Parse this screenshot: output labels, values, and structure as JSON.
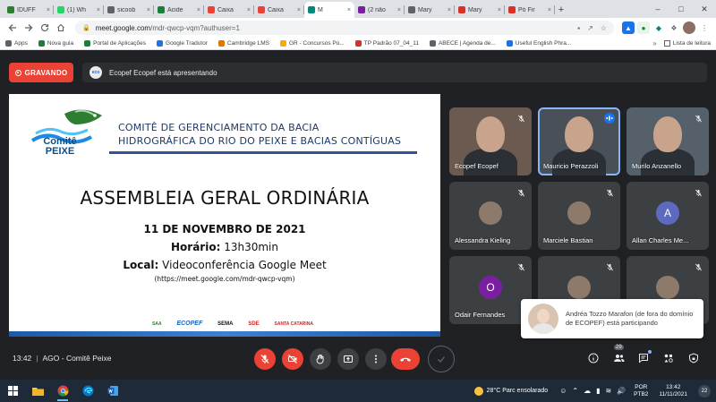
{
  "browser": {
    "tabs": [
      {
        "label": "IDUFF",
        "fav_color": "#2e7d32"
      },
      {
        "label": "(1) Wh",
        "fav_color": "#25d366"
      },
      {
        "label": "sicoob",
        "fav_color": "#5f6368"
      },
      {
        "label": "Acide",
        "fav_color": "#188038"
      },
      {
        "label": "Caixa",
        "fav_color": "#ea4335"
      },
      {
        "label": "Caixa",
        "fav_color": "#ea4335"
      },
      {
        "label": "M",
        "fav_color": "#00897b",
        "active": true
      },
      {
        "label": "(2 não",
        "fav_color": "#7b1fa2"
      },
      {
        "label": "Mary",
        "fav_color": "#5f6368"
      },
      {
        "label": "Mary",
        "fav_color": "#d93025"
      },
      {
        "label": "Pó Fir",
        "fav_color": "#d93025"
      }
    ],
    "url_host": "meet.google.com",
    "url_path": "/mdr-qwcp-vqm?authuser=1",
    "bookmarks": [
      {
        "label": "Apps",
        "color": "#5f6368"
      },
      {
        "label": "Nova guia",
        "color": "#188038"
      },
      {
        "label": "Portal de Aplicações",
        "color": "#188038"
      },
      {
        "label": "Google Tradutor",
        "color": "#1a73e8"
      },
      {
        "label": "Cambridge LMS",
        "color": "#e37400"
      },
      {
        "label": "GR - Concursos Pú...",
        "color": "#f9ab00"
      },
      {
        "label": "TP Padrão 07_04_11",
        "color": "#d93025"
      },
      {
        "label": "ABECE | Agenda de...",
        "color": "#5f6368"
      },
      {
        "label": "Useful English Phra...",
        "color": "#1a73e8"
      }
    ],
    "reading_list": "Lista de leitura"
  },
  "meet": {
    "recording_label": "GRAVANDO",
    "presenting_text": "Ecopef Ecopef está apresentando",
    "slide": {
      "logo_line1": "Comitê",
      "logo_line2": "PEIXE",
      "header_line1": "COMITÊ DE GERENCIAMENTO DA BACIA",
      "header_line2": "HIDROGRÁFICA DO RIO DO PEIXE E BACIAS CONTÍGUAS",
      "title": "ASSEMBLEIA GERAL ORDINÁRIA",
      "date": "11 DE NOVEMBRO DE 2021",
      "time_label": "Horário:",
      "time_value": "13h30min",
      "place_label": "Local:",
      "place_value": "Videoconferência Google Meet",
      "link": "(https://meet.google.com/mdr-qwcp-vqm)",
      "footer_logos": [
        "SAA",
        "ECOPEF",
        "SEMA",
        "SDE",
        "SANTA CATARINA"
      ]
    },
    "participants": [
      {
        "name": "Ecopef Ecopef",
        "muted": true,
        "video": true
      },
      {
        "name": "Mauricio Perazzoli",
        "muted": false,
        "speaking": true,
        "video": true
      },
      {
        "name": "Murilo Anzanello",
        "muted": true,
        "video": true
      },
      {
        "name": "Alessandra Kieling",
        "muted": true
      },
      {
        "name": "Marciele Bastian",
        "muted": true
      },
      {
        "name": "Allan Charles Me...",
        "muted": true,
        "initial": "A",
        "avatar_color": "#5c6bc0"
      },
      {
        "name": "Odair Fernandes",
        "muted": true,
        "initial": "O",
        "avatar_color": "#7b1fa2"
      },
      {
        "name": "",
        "muted": true
      },
      {
        "name": "",
        "muted": true
      }
    ],
    "toast": "Andréa Tozzo Marafon (de fora do domínio de ECOPEF) está participando",
    "meeting_time": "13:42",
    "meeting_separator": "|",
    "meeting_name": "AGO - Comitê Peixe",
    "people_count": "29"
  },
  "taskbar": {
    "weather_temp": "28°C",
    "weather_text": "Parc ensolarado",
    "lang_line1": "POR",
    "lang_line2": "PTB2",
    "time": "13:42",
    "date": "11/11/2021",
    "notifications": "22"
  }
}
